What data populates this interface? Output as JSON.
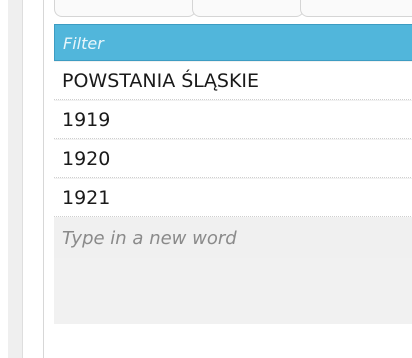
{
  "word_list": {
    "filter": {
      "placeholder": "Filter",
      "value": ""
    },
    "items": [
      {
        "label": "POWSTANIA ŚLĄSKIE"
      },
      {
        "label": "1919"
      },
      {
        "label": "1920"
      },
      {
        "label": "1921"
      }
    ],
    "new_word": {
      "placeholder": "Type in a new word",
      "value": ""
    }
  },
  "colors": {
    "filter_background": "#51b6db",
    "list_background": "#f1f1f1",
    "row_background": "#ffffff",
    "text": "#1a1a1a"
  }
}
